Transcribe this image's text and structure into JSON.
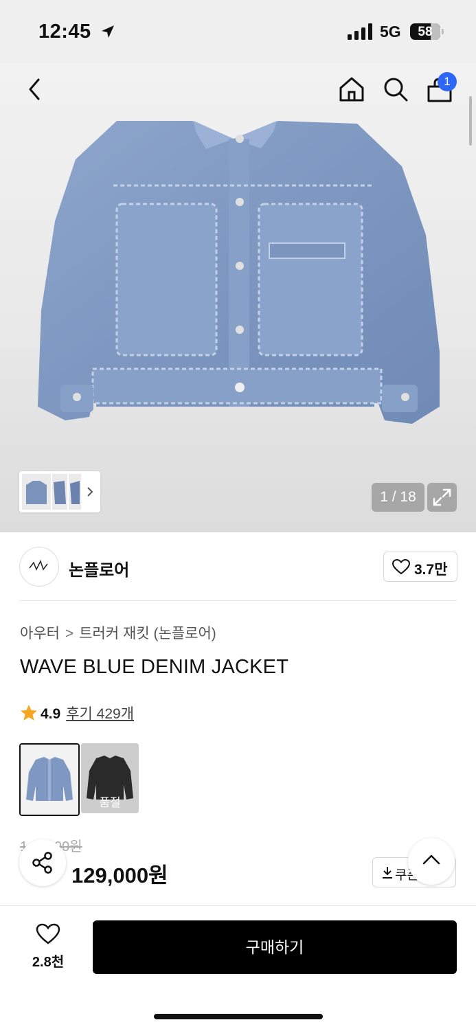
{
  "status_bar": {
    "time": "12:45",
    "network": "5G",
    "battery": "58"
  },
  "header": {
    "cart_count": "1"
  },
  "gallery": {
    "counter": "1 / 18"
  },
  "brand": {
    "name": "논플로어",
    "likes": "3.7만"
  },
  "breadcrumb": {
    "category": "아우터",
    "separator": ">",
    "subcategory": "트러커 재킷 (논플로어)"
  },
  "product": {
    "title": "WAVE BLUE DENIM JACKET",
    "rating": "4.9",
    "reviews_label": "후기 429개",
    "colors": [
      {
        "name": "wave blue",
        "sold_out": false
      },
      {
        "name": "black",
        "sold_out": true,
        "sold_out_label": "품절"
      }
    ],
    "original_price": "1?‌?,000원",
    "price": "129,000원",
    "coupon_label": "쿠폰"
  },
  "bottom_bar": {
    "wish_count": "2.8천",
    "buy_label": "구매하기"
  },
  "colors": {
    "accent": "#2e66f5",
    "discount": "#ee2d2d",
    "star": "#f5a623"
  }
}
